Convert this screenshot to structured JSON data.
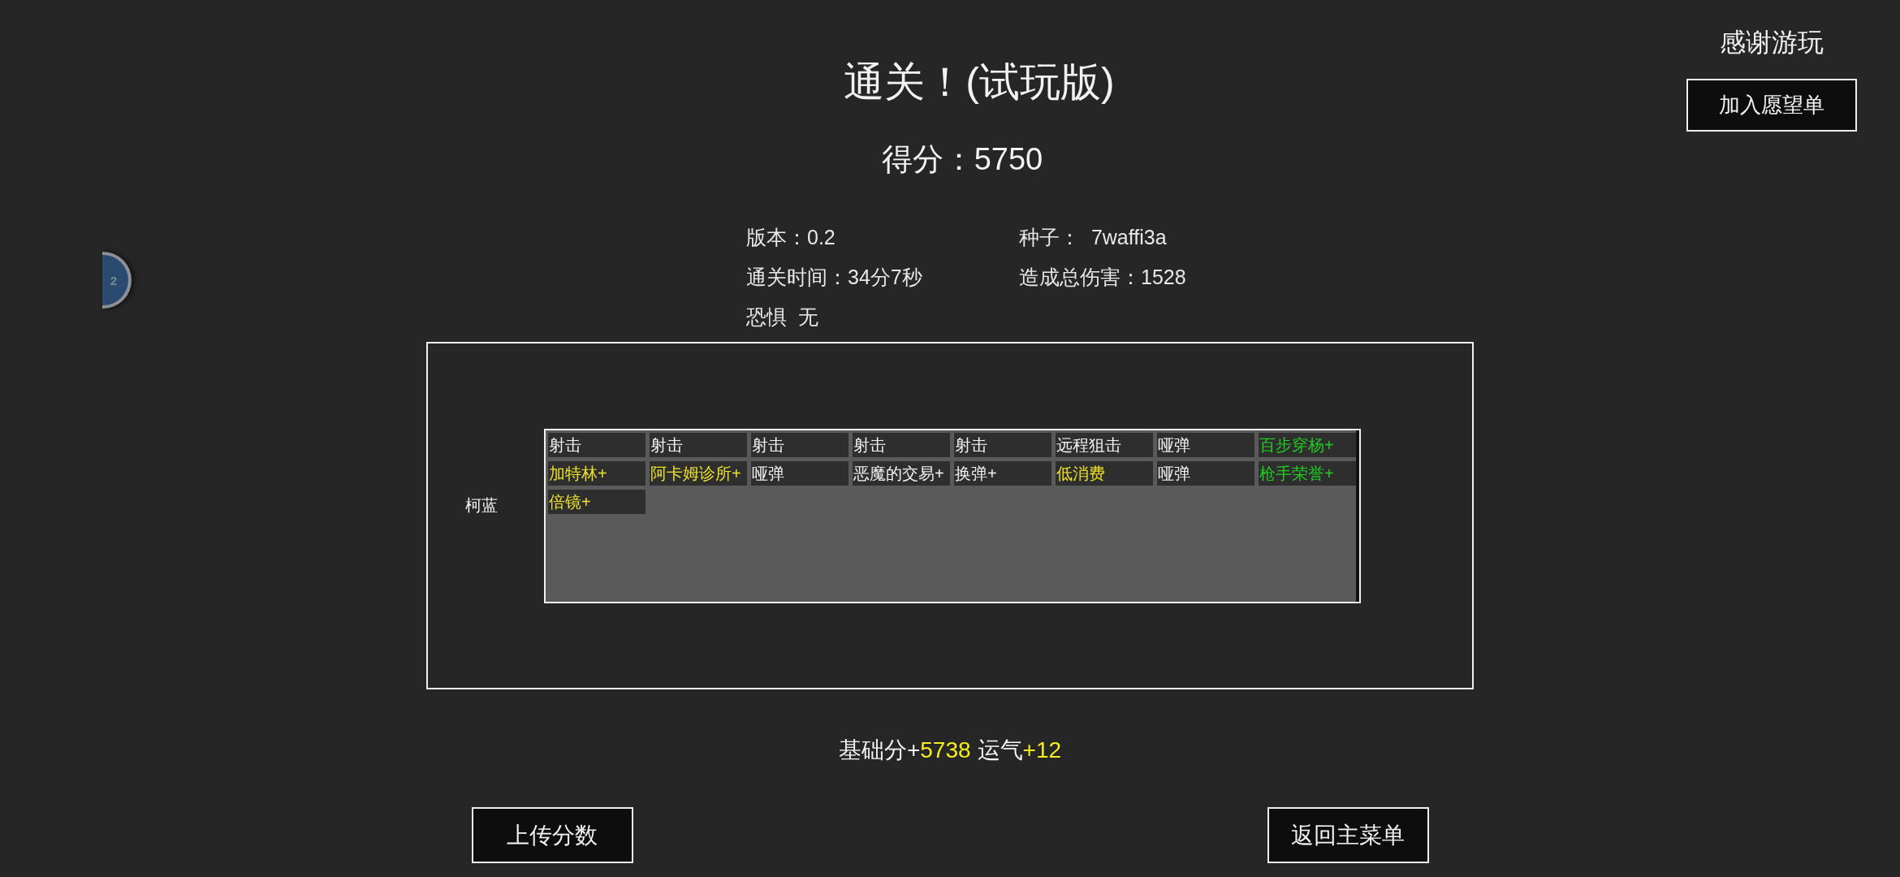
{
  "side_badge": {
    "text": "2"
  },
  "header": {
    "title": "通关！(试玩版)",
    "score": "得分：5750"
  },
  "thanks": {
    "text": "感谢游玩",
    "wishlist_button": "加入愿望单"
  },
  "run_info": [
    {
      "text": "版本：0.2"
    },
    {
      "text": "种子：  7waffi3a"
    },
    {
      "text": "通关时间：34分7秒"
    },
    {
      "text": "造成总伤害：1528"
    },
    {
      "text": "恐惧  无"
    }
  ],
  "deck": {
    "character": "柯蓝",
    "cards": [
      {
        "name": "射击",
        "kind": "white"
      },
      {
        "name": "射击",
        "kind": "white"
      },
      {
        "name": "射击",
        "kind": "white"
      },
      {
        "name": "射击",
        "kind": "white"
      },
      {
        "name": "射击",
        "kind": "white"
      },
      {
        "name": "远程狙击",
        "kind": "white"
      },
      {
        "name": "哑弹",
        "kind": "white"
      },
      {
        "name": "百步穿杨+",
        "kind": "green"
      },
      {
        "name": "加特林+",
        "kind": "yellow"
      },
      {
        "name": "阿卡姆诊所+",
        "kind": "yellow"
      },
      {
        "name": "哑弹",
        "kind": "white"
      },
      {
        "name": "恶魔的交易+",
        "kind": "white"
      },
      {
        "name": "换弹+",
        "kind": "white"
      },
      {
        "name": "低消费",
        "kind": "yellow"
      },
      {
        "name": "哑弹",
        "kind": "white"
      },
      {
        "name": "枪手荣誉+",
        "kind": "green"
      },
      {
        "name": "倍镜+",
        "kind": "yellow"
      }
    ]
  },
  "score_breakdown": [
    {
      "label": "基础分+",
      "value": "5738"
    },
    {
      "label": "运气",
      "value": "+12"
    }
  ],
  "buttons": [
    {
      "label": "上传分数"
    },
    {
      "label": "返回主菜单"
    }
  ]
}
